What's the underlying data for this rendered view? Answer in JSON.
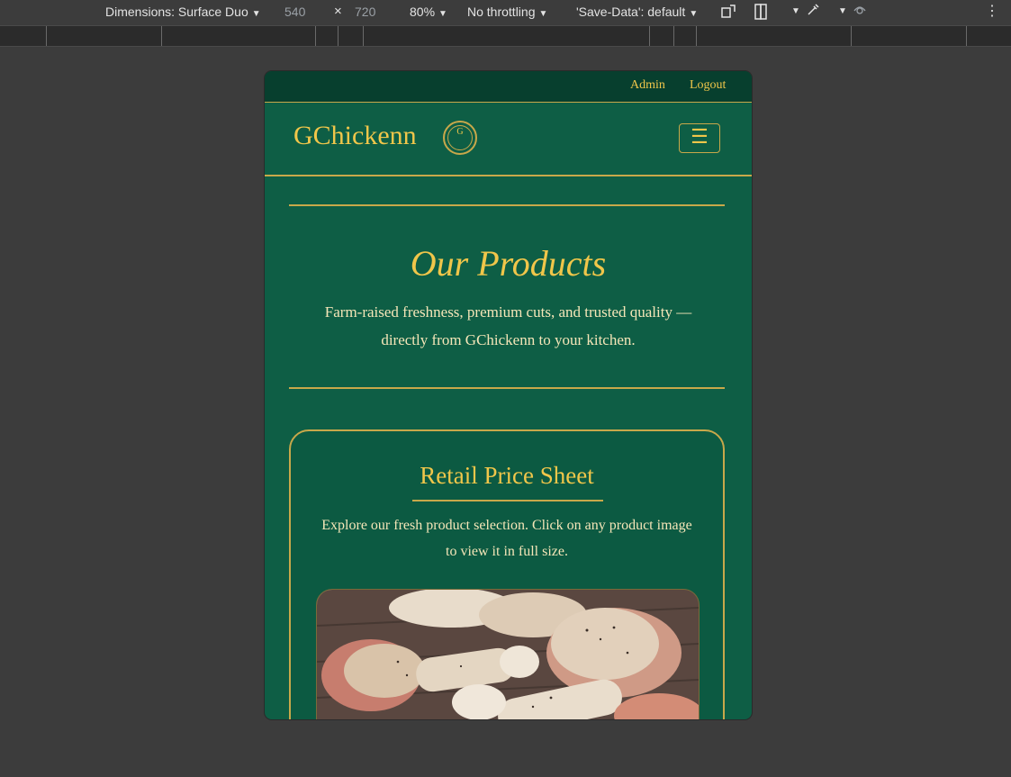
{
  "devtools": {
    "dimensions_label": "Dimensions: Surface Duo",
    "width": "540",
    "times": "×",
    "height": "720",
    "zoom": "80%",
    "throttling": "No throttling",
    "save_data": "'Save-Data': default"
  },
  "topbar": {
    "admin_label": "Admin",
    "logout_label": "Logout"
  },
  "navbar": {
    "brand": "GChickenn",
    "logo_text": "G",
    "menu_icon": "☰"
  },
  "hero": {
    "title": "Our Products",
    "subtitle": "Farm-raised freshness, premium cuts, and trusted quality — directly from GChickenn to your kitchen."
  },
  "card": {
    "title": "Retail Price Sheet",
    "text": "Explore our fresh product selection. Click on any product image to view it in full size."
  },
  "colors": {
    "primary_green": "#0e5e45",
    "dark_green": "#073f2e",
    "gold": "#f0c64a",
    "cream_text": "#f5e6b8"
  }
}
